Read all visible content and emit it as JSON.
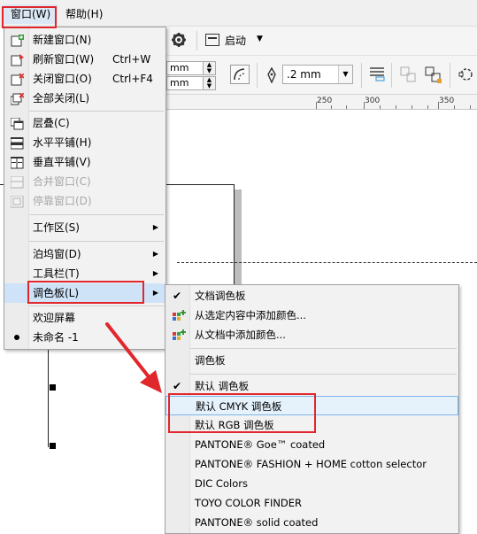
{
  "menubar": {
    "items": [
      {
        "label": "窗口(W)",
        "active": true
      },
      {
        "label": "帮助(H)",
        "active": false
      }
    ]
  },
  "toolbar": {
    "launch_label": "启动",
    "unit_1": "mm",
    "unit_2": "mm",
    "outline_width": ".2 mm"
  },
  "ruler": {
    "labels": [
      "250",
      "300",
      "350"
    ]
  },
  "window_menu": {
    "items": [
      {
        "label": "新建窗口(N)",
        "shortcut": "",
        "icon": "new-window-icon",
        "disabled": false
      },
      {
        "label": "刷新窗口(W)",
        "shortcut": "Ctrl+W",
        "icon": "refresh-window-icon",
        "disabled": false
      },
      {
        "label": "关闭窗口(O)",
        "shortcut": "Ctrl+F4",
        "icon": "close-window-icon",
        "disabled": false
      },
      {
        "label": "全部关闭(L)",
        "shortcut": "",
        "icon": "close-all-icon",
        "disabled": false
      },
      {
        "label": "层叠(C)",
        "shortcut": "",
        "icon": "cascade-icon",
        "disabled": false
      },
      {
        "label": "水平平铺(H)",
        "shortcut": "",
        "icon": "tile-horizontal-icon",
        "disabled": false
      },
      {
        "label": "垂直平铺(V)",
        "shortcut": "",
        "icon": "tile-vertical-icon",
        "disabled": false
      },
      {
        "label": "合并窗口(C)",
        "shortcut": "",
        "icon": "merge-windows-icon",
        "disabled": true
      },
      {
        "label": "停靠窗口(D)",
        "shortcut": "",
        "icon": "dock-window-icon",
        "disabled": true
      },
      {
        "label": "工作区(S)",
        "shortcut": "",
        "icon": "",
        "disabled": false
      },
      {
        "label": "泊坞窗(D)",
        "shortcut": "",
        "icon": "",
        "disabled": false
      },
      {
        "label": "工具栏(T)",
        "shortcut": "",
        "icon": "",
        "disabled": false
      },
      {
        "label": "调色板(L)",
        "shortcut": "",
        "icon": "",
        "disabled": false
      },
      {
        "label": "欢迎屏幕",
        "shortcut": "",
        "icon": "",
        "disabled": false
      },
      {
        "label": "未命名 -1",
        "shortcut": "",
        "icon": "bullet-icon",
        "disabled": false
      }
    ]
  },
  "palette_submenu": {
    "items": [
      {
        "label": "文档调色板",
        "checked": true
      },
      {
        "label": "从选定内容中添加颜色...",
        "checked": false
      },
      {
        "label": "从文档中添加颜色...",
        "checked": false
      },
      {
        "label": "调色板",
        "checked": false
      },
      {
        "label": "默认 调色板",
        "checked": true
      },
      {
        "label": "默认 CMYK 调色板",
        "checked": false
      },
      {
        "label": "默认 RGB 调色板",
        "checked": false
      },
      {
        "label": "PANTONE® Goe™ coated",
        "checked": false
      },
      {
        "label": "PANTONE® FASHION + HOME cotton selector",
        "checked": false
      },
      {
        "label": "DIC Colors",
        "checked": false
      },
      {
        "label": "TOYO COLOR FINDER",
        "checked": false
      },
      {
        "label": "PANTONE® solid coated",
        "checked": false
      }
    ]
  },
  "colors": {
    "highlight_red": "#e0272c",
    "menu_bg": "#f2f2f2",
    "selected_blue": "#cfe3f8"
  }
}
